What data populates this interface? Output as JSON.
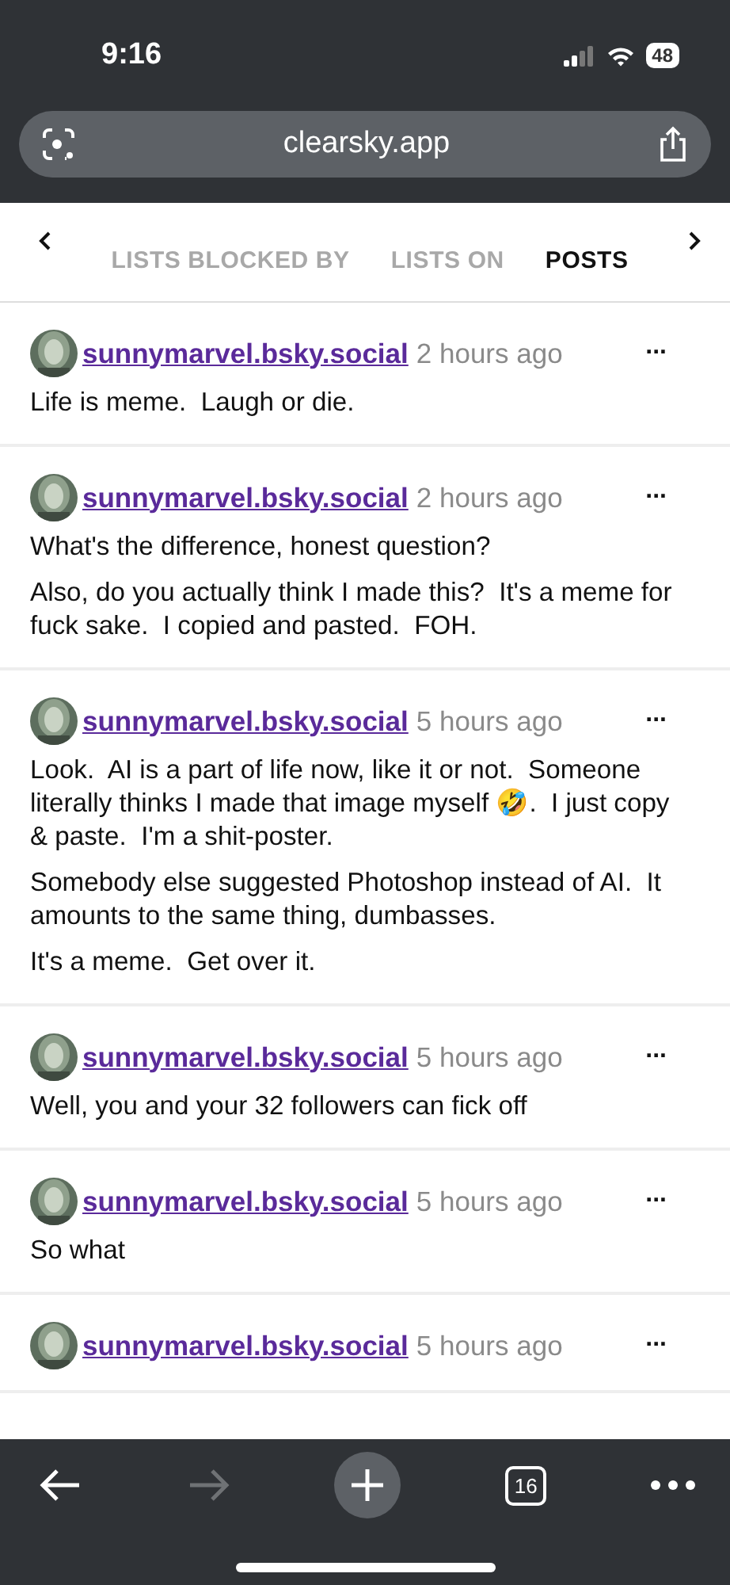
{
  "status_bar": {
    "time": "9:16",
    "battery": "48"
  },
  "address_bar": {
    "url": "clearsky.app"
  },
  "tabs": [
    {
      "label": "LISTS BLOCKED BY",
      "selected": false
    },
    {
      "label": "LISTS ON",
      "selected": false
    },
    {
      "label": "POSTS",
      "selected": true
    }
  ],
  "posts": [
    {
      "author": "sunnymarvel.bsky.social",
      "time": "2 hours ago",
      "more": "...",
      "paragraphs": [
        "Life is meme.  Laugh or die."
      ]
    },
    {
      "author": "sunnymarvel.bsky.social",
      "time": "2 hours ago",
      "more": "...",
      "paragraphs": [
        "What's the difference, honest question?",
        "Also, do you actually think I made this?  It's a meme for fuck sake.  I copied and pasted.  FOH."
      ]
    },
    {
      "author": "sunnymarvel.bsky.social",
      "time": "5 hours ago",
      "more": "...",
      "paragraphs": [
        "Look.  AI is a part of life now, like it or not.  Someone literally thinks I made that image myself 🤣.  I just copy & paste.  I'm a shit-poster.",
        "Somebody else suggested Photoshop instead of AI.  It amounts to the same thing, dumbasses.",
        "It's a meme.  Get over it."
      ]
    },
    {
      "author": "sunnymarvel.bsky.social",
      "time": "5 hours ago",
      "more": "...",
      "paragraphs": [
        "Well, you and your 32 followers can fick off"
      ]
    },
    {
      "author": "sunnymarvel.bsky.social",
      "time": "5 hours ago",
      "more": "...",
      "paragraphs": [
        "So what"
      ]
    },
    {
      "author": "sunnymarvel.bsky.social",
      "time": "5 hours ago",
      "more": "..."
    }
  ],
  "toolbar": {
    "tab_count": "16",
    "forward_disabled": true
  }
}
